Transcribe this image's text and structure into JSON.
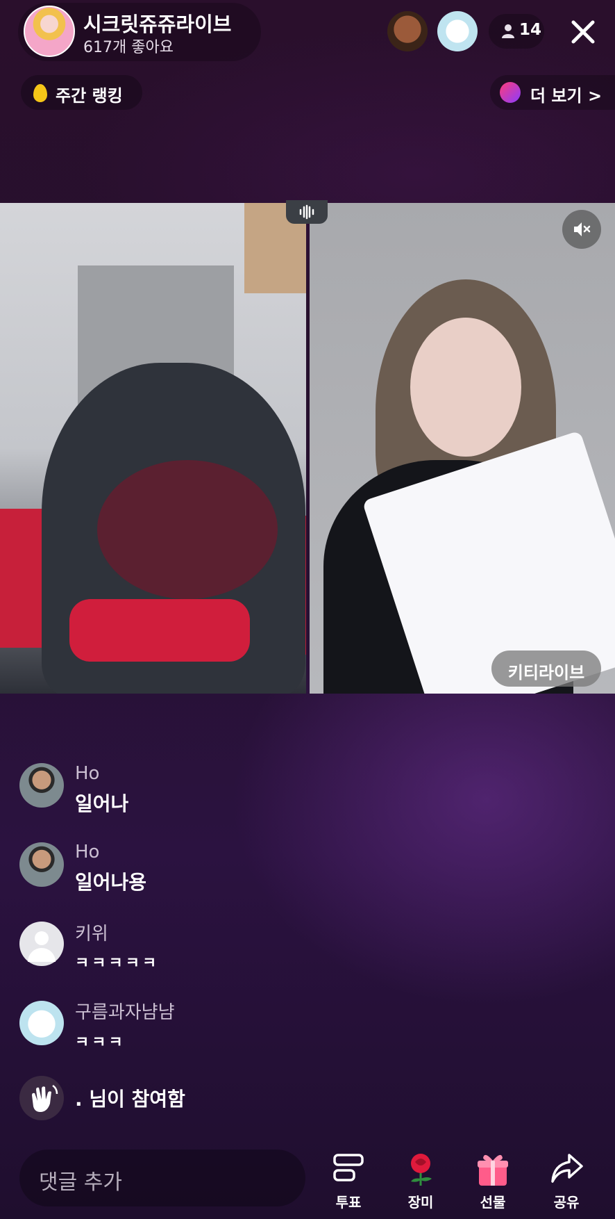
{
  "header": {
    "host_name": "시크릿쥬쥬라이브",
    "likes": "617개 좋아요",
    "viewer_count": "14",
    "ranking_label": "주간 랭킹",
    "more_label": "더 보기 >"
  },
  "video": {
    "right_tag": "키티라이브"
  },
  "chat": [
    {
      "name": "Ho",
      "text": "일어나"
    },
    {
      "name": "Ho",
      "text": "일어나용"
    },
    {
      "name": "키위",
      "text": "ㅋㅋㅋㅋㅋ"
    },
    {
      "name": "구름과자냠냠",
      "text": "ㅋㅋㅋ"
    },
    {
      "name": "",
      "text": ". 님이 참여함"
    }
  ],
  "bottom_bar": {
    "comment_placeholder": "댓글 추가",
    "actions": [
      {
        "label": "투표",
        "icon": "poll-icon"
      },
      {
        "label": "장미",
        "icon": "rose-icon"
      },
      {
        "label": "선물",
        "icon": "gift-icon"
      },
      {
        "label": "공유",
        "icon": "share-icon"
      }
    ]
  },
  "colors": {
    "background": "#2a0f2c",
    "accent_gift": "#ff5c8a",
    "rose": "#e01a3c"
  }
}
